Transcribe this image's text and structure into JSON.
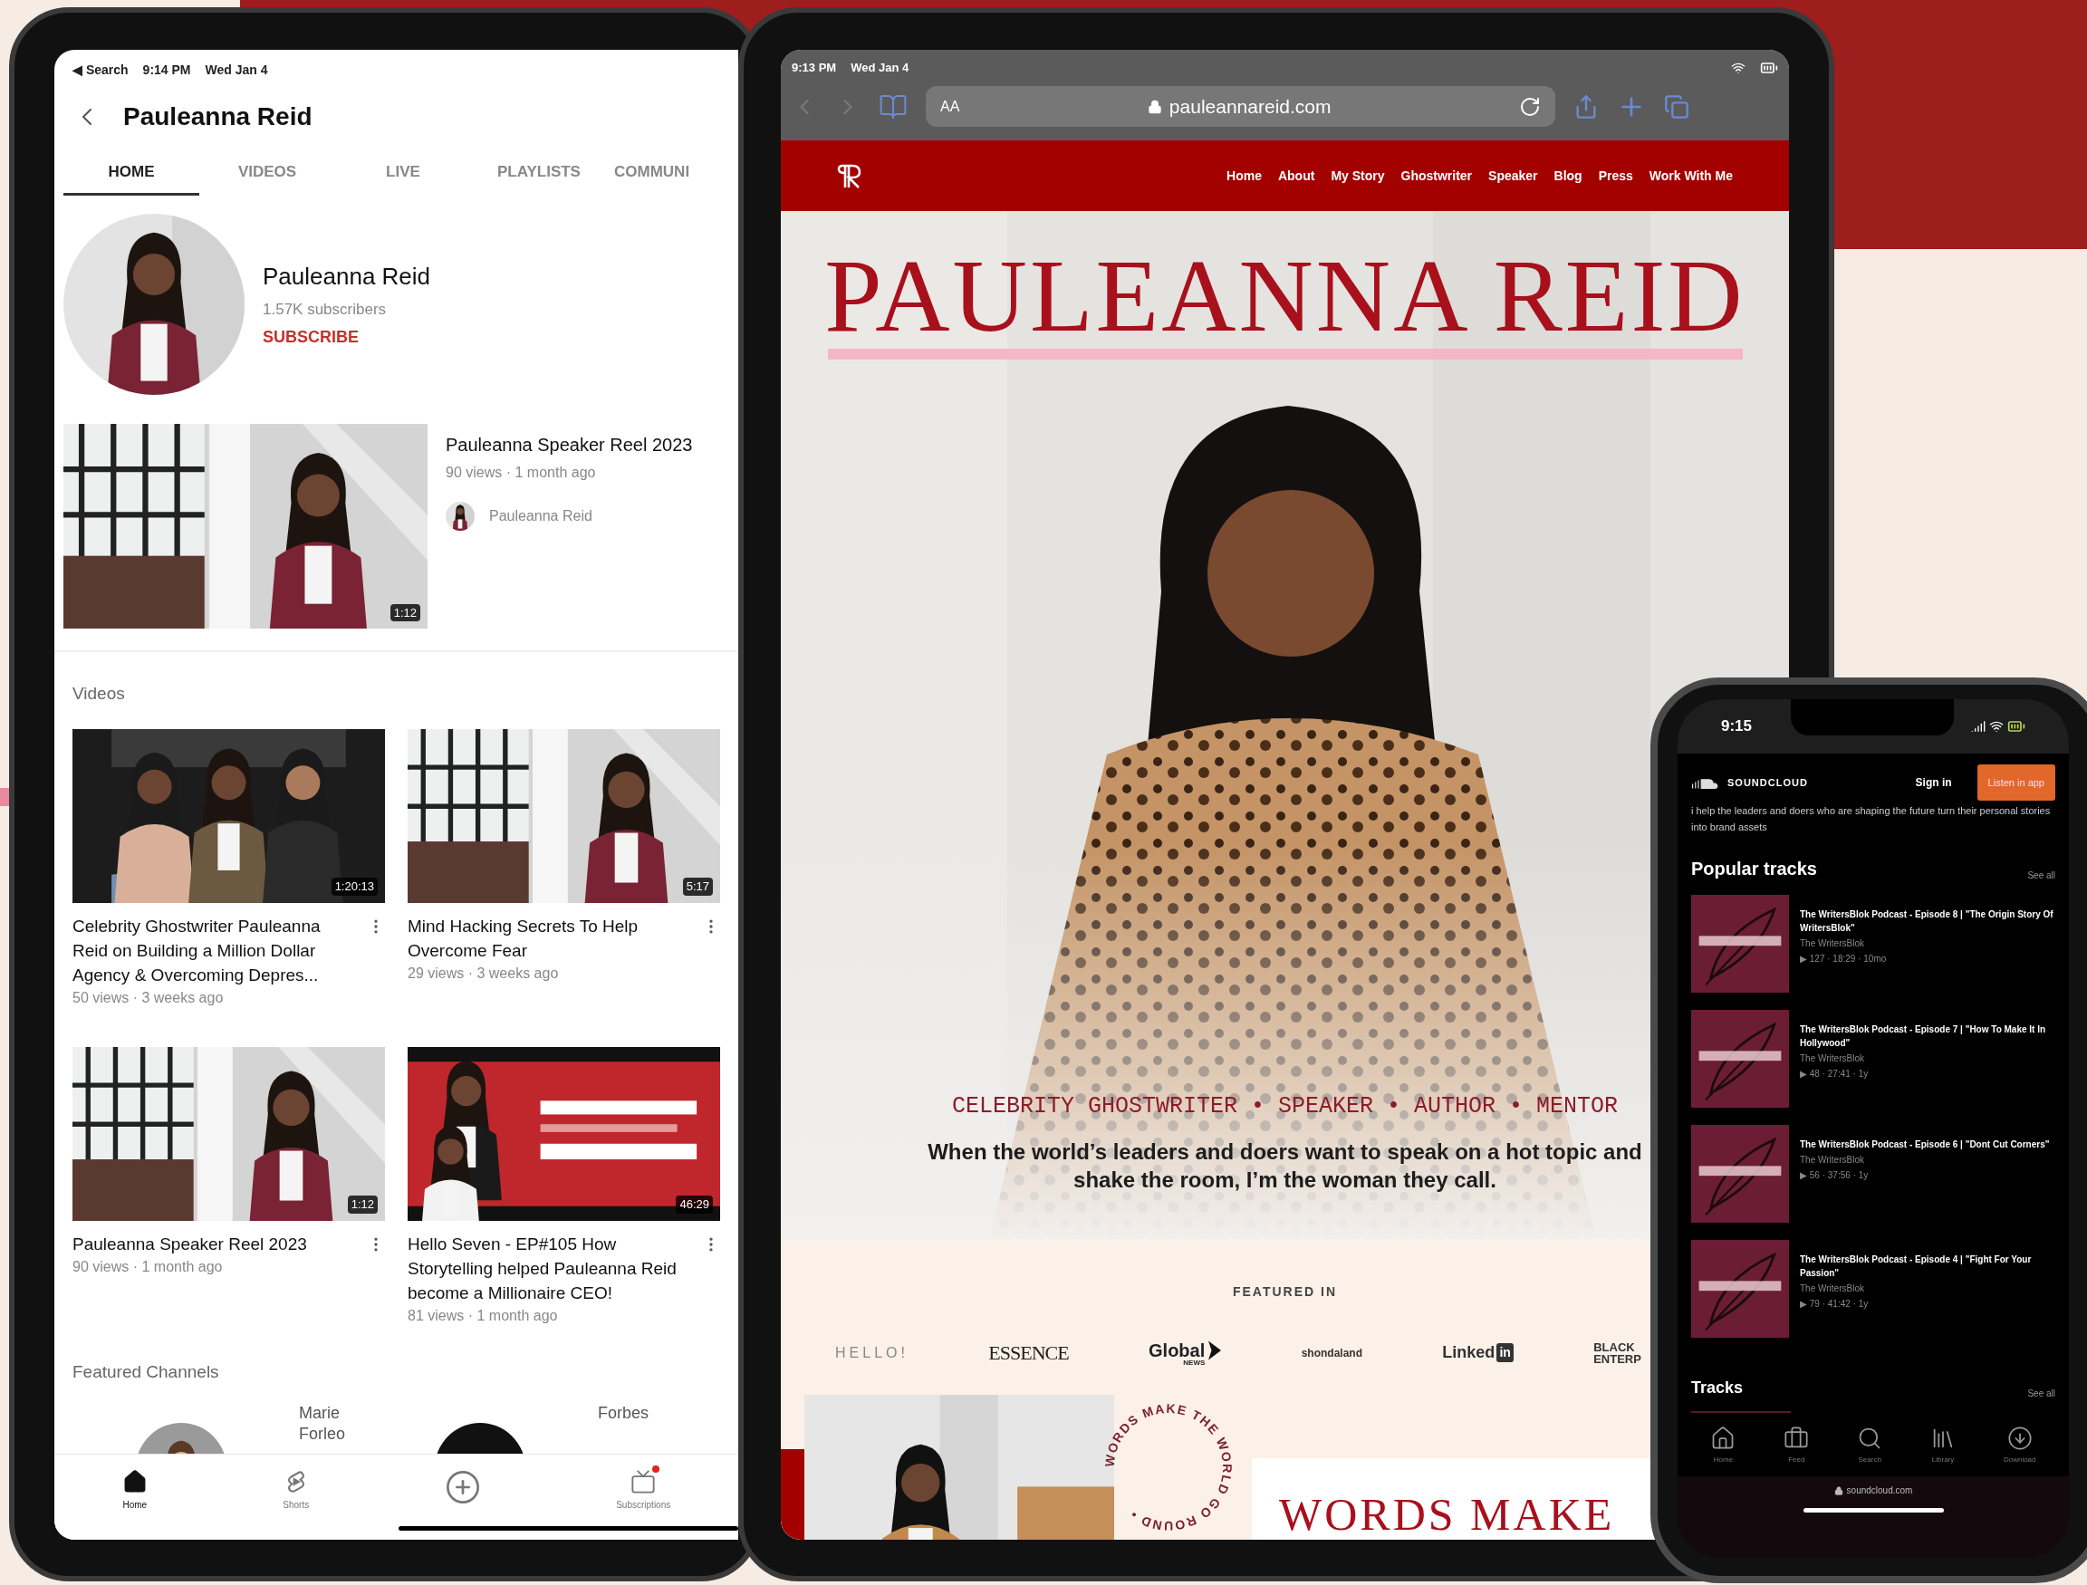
{
  "youtube_tablet": {
    "status_bar": {
      "back_label": "◀ Search",
      "time": "9:14 PM",
      "date": "Wed Jan 4"
    },
    "header": {
      "title": "Pauleanna Reid"
    },
    "tabs": [
      {
        "label": "HOME",
        "selected": true
      },
      {
        "label": "VIDEOS",
        "selected": false
      },
      {
        "label": "LIVE",
        "selected": false
      },
      {
        "label": "PLAYLISTS",
        "selected": false
      },
      {
        "label": "COMMUNI",
        "selected": false
      }
    ],
    "channel": {
      "name": "Pauleanna Reid",
      "subscribers": "1.57K subscribers",
      "subscribe": "SUBSCRIBE"
    },
    "featured_video": {
      "title": "Pauleanna Speaker Reel 2023",
      "meta": "90 views · 1 month ago",
      "channel": "Pauleanna Reid",
      "duration": "1:12"
    },
    "videos_heading": "Videos",
    "videos": [
      {
        "title": "Celebrity Ghostwriter Pauleanna Reid on Building a Million Dollar Agency & Overcoming Depres...",
        "meta": "50 views · 3 weeks ago",
        "duration": "1:20:13"
      },
      {
        "title": "Mind Hacking Secrets To Help Overcome Fear",
        "meta": "29 views · 3 weeks ago",
        "duration": "5:17"
      },
      {
        "title": "Pauleanna Speaker Reel 2023",
        "meta": "90 views · 1 month ago",
        "duration": "1:12"
      },
      {
        "title": "Hello Seven - EP#105 How Storytelling helped Pauleanna Reid become a Millionaire CEO!",
        "meta": "81 views · 1 month ago",
        "duration": "46:29"
      }
    ],
    "featured_channels": {
      "heading": "Featured Channels",
      "channels": [
        {
          "name": "Marie Forleo",
          "kind": "person"
        },
        {
          "name": "Forbes",
          "kind": "logo"
        }
      ]
    },
    "bottom_nav": [
      {
        "kind": "home",
        "label": "Home",
        "selected": true,
        "badge": false
      },
      {
        "kind": "shorts",
        "label": "Shorts",
        "selected": false,
        "badge": false
      },
      {
        "kind": "create",
        "selected": false,
        "badge": false
      },
      {
        "kind": "subscriptions",
        "label": "Subscriptions",
        "selected": false,
        "badge": true
      }
    ]
  },
  "browser_tablet": {
    "status_bar": {
      "time": "9:13 PM",
      "date": "Wed Jan 4"
    },
    "toolbar": {
      "text_size": "AA",
      "url": "pauleannareid.com"
    },
    "site": {
      "nav": [
        {
          "label": "Home"
        },
        {
          "label": "About"
        },
        {
          "label": "My Story"
        },
        {
          "label": "Ghostwriter"
        },
        {
          "label": "Speaker"
        },
        {
          "label": "Blog"
        },
        {
          "label": "Press"
        },
        {
          "label": "Work With Me"
        }
      ],
      "hero": {
        "title": "PAULEANNA REID",
        "tagline": "CELEBRITY GHOSTWRITER • SPEAKER • AUTHOR • MENTOR",
        "statement": "When the world’s leaders and doers want to speak on a hot topic and shake the room, I’m the woman they call."
      },
      "featured": {
        "heading": "FEATURED IN",
        "logos": [
          {
            "kind": "spaced",
            "text": "HELLO!"
          },
          {
            "kind": "condensed",
            "text": "ESSENCE"
          },
          {
            "kind": "global",
            "text": "Global",
            "sub": "NEWS"
          },
          {
            "kind": "small",
            "text": "shondaland"
          },
          {
            "kind": "linkedin",
            "text": "Linked",
            "mark": "in"
          },
          {
            "kind": "stacked",
            "lines": [
              "BLACK",
              "ENTERP"
            ]
          }
        ]
      },
      "badge_text": "WORDS MAKE THE WORLD GO ROUND •",
      "section_title": "WORDS MAKE"
    }
  },
  "soundcloud_phone": {
    "status_bar": {
      "time": "9:15"
    },
    "header": {
      "brand": "SOUNDCLOUD",
      "sign_in": "Sign in",
      "cta": "Listen in app"
    },
    "bio": "i help the leaders and doers who are shaping the future turn their personal stories into brand assets",
    "popular": {
      "heading": "Popular tracks",
      "see_all": "See all",
      "tracks": [
        {
          "title": "The WritersBlok Podcast - Episode 8 | \"The Origin Story Of WritersBlok\"",
          "artist": "The WritersBlok",
          "stats": "▶ 127 · 18:29 · 10mo"
        },
        {
          "title": "The WritersBlok Podcast - Episode 7 | \"How To Make It In Hollywood\"",
          "artist": "The WritersBlok",
          "stats": "▶ 48 · 27:41 · 1y"
        },
        {
          "title": "The WritersBlok Podcast - Episode 6 | \"Dont Cut Corners\"",
          "artist": "The WritersBlok",
          "stats": "▶ 56 · 37:56 · 1y"
        },
        {
          "title": "The WritersBlok Podcast - Episode 4 | \"Fight For Your Passion\"",
          "artist": "The WritersBlok",
          "stats": "▶ 79 · 41:42 · 1y"
        }
      ]
    },
    "tracks_section": {
      "heading": "Tracks",
      "see_all": "See all"
    },
    "bottom_nav": [
      {
        "kind": "home",
        "label": "Home"
      },
      {
        "kind": "feed",
        "label": "Feed"
      },
      {
        "kind": "search",
        "label": "Search"
      },
      {
        "kind": "library",
        "label": "Library"
      },
      {
        "kind": "download",
        "label": "Download"
      }
    ],
    "address": "soundcloud.com"
  }
}
